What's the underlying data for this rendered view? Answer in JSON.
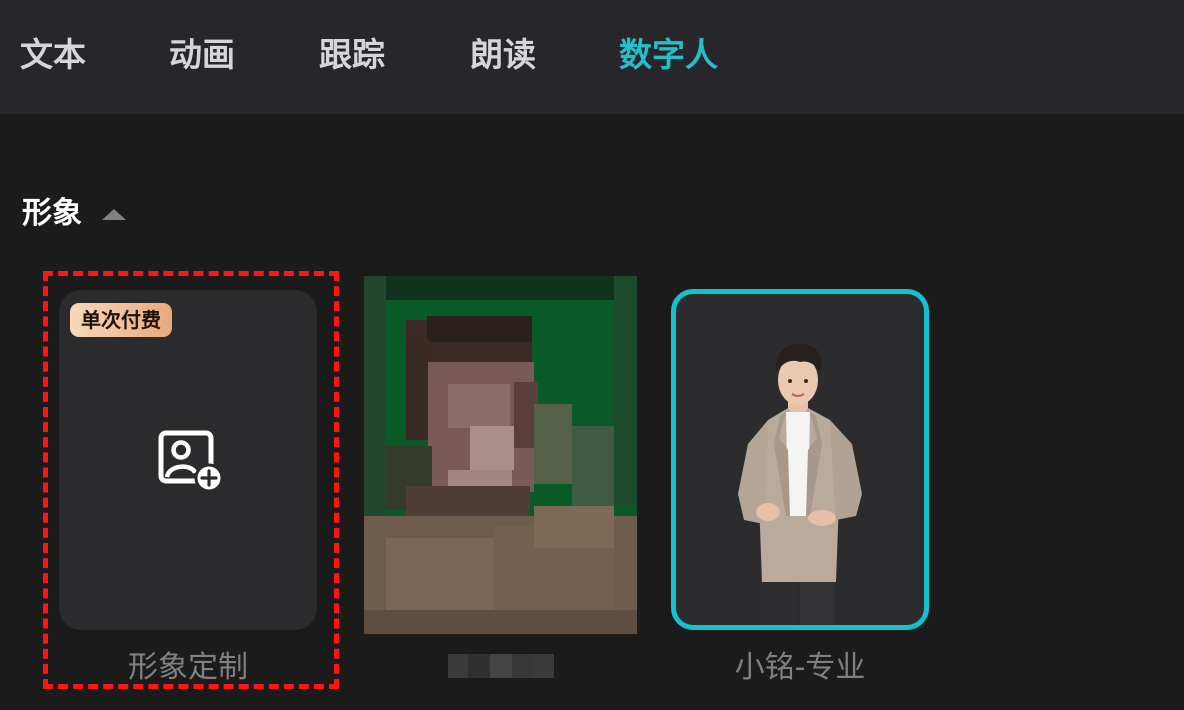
{
  "tabs": [
    {
      "label": "文本"
    },
    {
      "label": "动画"
    },
    {
      "label": "跟踪"
    },
    {
      "label": "朗读"
    },
    {
      "label": "数字人",
      "active": true
    }
  ],
  "section": {
    "title": "形象",
    "expanded": true
  },
  "cards": {
    "custom": {
      "badge": "单次付费",
      "label": "形象定制"
    },
    "blurred": {
      "label": ""
    },
    "avatar": {
      "label": "小铭-专业",
      "selected": true
    }
  },
  "colors": {
    "accent": "#25bfcb",
    "highlight_outline": "#ff1515",
    "badge_from": "#f7d8b9",
    "badge_to": "#eaa97f"
  }
}
